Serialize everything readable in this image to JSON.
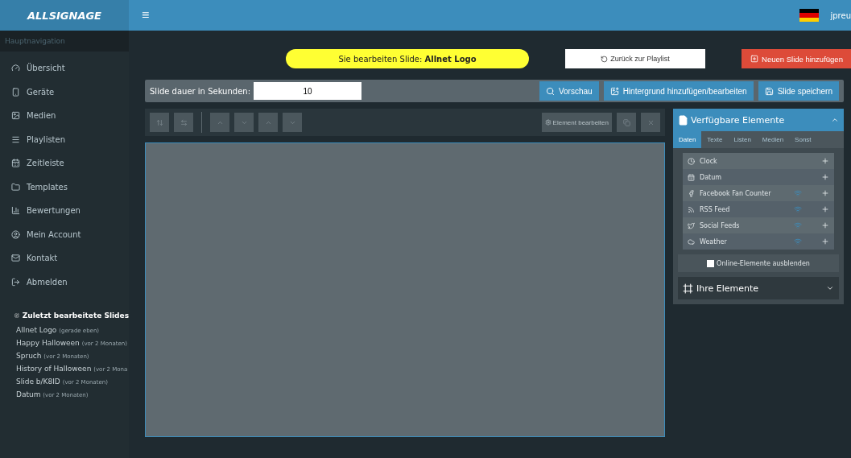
{
  "header": {
    "logo": "ALLSIGNAGE",
    "menu_toggle": "≡",
    "user": "jpreu"
  },
  "sidebar": {
    "heading": "Hauptnavigation",
    "items": [
      {
        "label": "Übersicht"
      },
      {
        "label": "Geräte"
      },
      {
        "label": "Medien"
      },
      {
        "label": "Playlisten"
      },
      {
        "label": "Zeitleiste"
      },
      {
        "label": "Templates"
      },
      {
        "label": "Bewertungen"
      },
      {
        "label": "Mein Account"
      },
      {
        "label": "Kontakt"
      },
      {
        "label": "Abmelden"
      }
    ],
    "recent": {
      "title": "Zuletzt bearbeitete Slides",
      "items": [
        {
          "name": "Allnet Logo",
          "time": "(gerade eben)"
        },
        {
          "name": "Happy Halloween",
          "time": "(vor 2 Monaten)"
        },
        {
          "name": "Spruch",
          "time": "(vor 2 Monaten)"
        },
        {
          "name": "History of Halloween",
          "time": "(vor 2 Mona"
        },
        {
          "name": "Slide b/K8ID",
          "time": "(vor 2 Monaten)"
        },
        {
          "name": "Datum",
          "time": "(vor 2 Monaten)"
        }
      ]
    }
  },
  "editing_notice": "Sie bearbeiten Slide: **Allnet Logo**",
  "back_button": "Zurück zur Playlist",
  "new_slide_button": "Neuen Slide hinzufügen",
  "duration": {
    "label": "Slide dauer in Sekunden:",
    "value": "10"
  },
  "actions": [
    "Vorschau",
    "Hintergrund hinzufügen/bearbeiten",
    "Slide speichern"
  ],
  "toolbar": {
    "element_button": "Element bearbeiten"
  },
  "available_panel": {
    "title": "Verfügbare Elemente",
    "expanded": true,
    "tabs": [
      {
        "label": "Daten",
        "selected": true
      },
      {
        "label": "Texte",
        "selected": false
      },
      {
        "label": "Listen",
        "selected": false
      },
      {
        "label": "Medien",
        "selected": false
      },
      {
        "label": "Sonst",
        "selected": false
      }
    ],
    "elements": [
      {
        "label": "Clock",
        "online": false
      },
      {
        "label": "Datum",
        "online": false
      },
      {
        "label": "Facebook Fan Counter",
        "online": true
      },
      {
        "label": "RSS Feed",
        "online": true
      },
      {
        "label": "Social Feeds",
        "online": true
      },
      {
        "label": "Weather",
        "online": true
      }
    ],
    "hide_online": {
      "label": "Online-Elemente ausblenden",
      "checked": false
    }
  },
  "own_panel": {
    "title": "Ihre Elemente",
    "expanded": false
  }
}
